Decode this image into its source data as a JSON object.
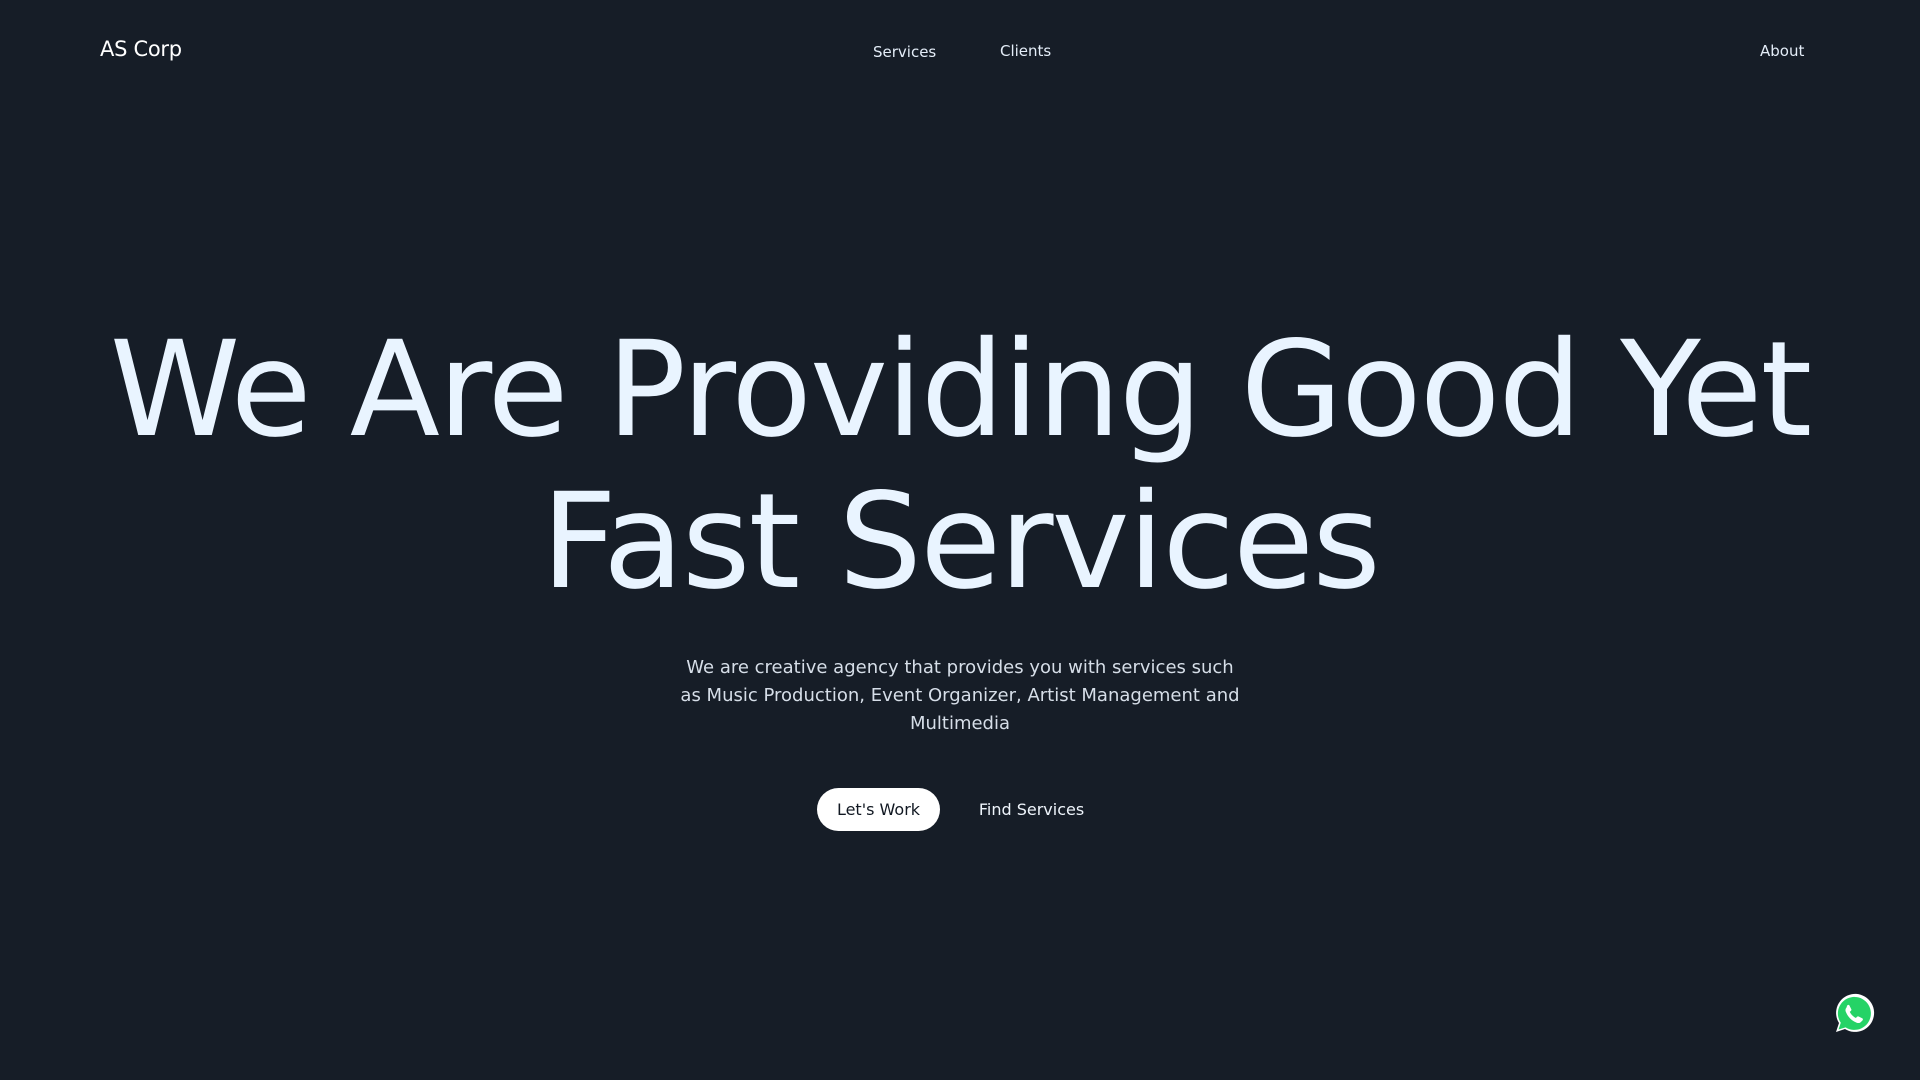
{
  "header": {
    "brand": "AS Corp",
    "nav": {
      "services": "Services",
      "clients": "Clients",
      "about": "About"
    }
  },
  "hero": {
    "title_line1": "We Are Providing Good Yet",
    "title_line2": "Fast Services",
    "subtitle": "We are creative agency that provides you with services such as Music Production, Event Organizer, Artist Management and Multimedia",
    "primary_button": "Let's Work",
    "secondary_button": "Find Services"
  },
  "floating": {
    "whatsapp_icon": "whatsapp-icon"
  },
  "colors": {
    "background": "#161d27",
    "headline": "#e9f4ff",
    "button_bg": "#ffffff",
    "whatsapp_green": "#25d366"
  }
}
